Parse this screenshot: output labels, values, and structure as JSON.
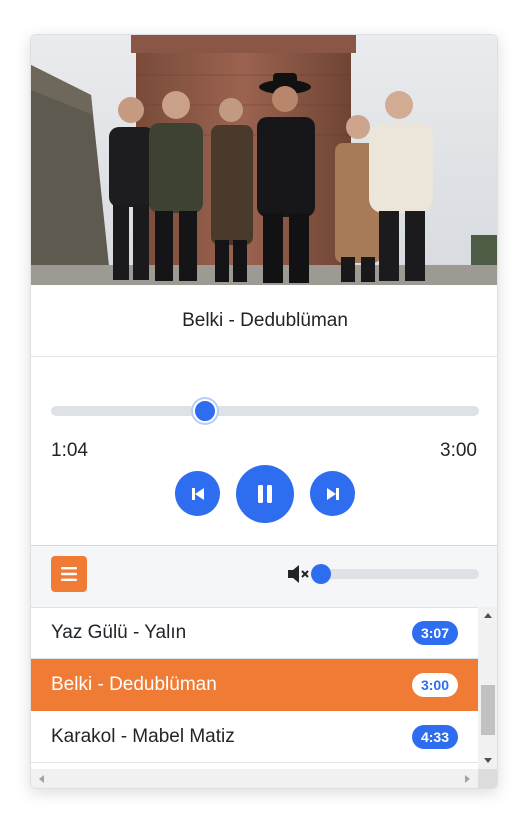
{
  "player": {
    "now_playing": "Belki - Dedublüman",
    "current_time": "1:04",
    "duration": "3:00",
    "progress_fraction": 0.36
  },
  "controls": {
    "prev_icon": "skip-previous-icon",
    "pause_icon": "pause-icon",
    "next_icon": "skip-next-icon"
  },
  "toolbar": {
    "menu_icon": "hamburger-menu-icon",
    "mute_icon": "volume-muted-icon",
    "volume_fraction": 0.0
  },
  "playlist": [
    {
      "title": "Yaz Gülü - Yalın",
      "duration": "3:07",
      "active": false
    },
    {
      "title": "Belki - Dedublüman",
      "duration": "3:00",
      "active": true
    },
    {
      "title": "Karakol - Mabel Matiz",
      "duration": "4:33",
      "active": false
    }
  ],
  "colors": {
    "accent_blue": "#2f6df0",
    "active_orange": "#f07b35",
    "track_gray": "#dee2e6"
  }
}
